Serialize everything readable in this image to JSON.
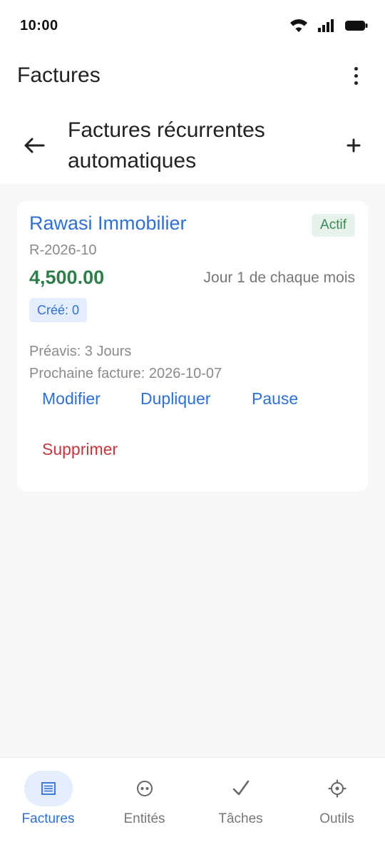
{
  "status_bar": {
    "time": "10:00"
  },
  "app_bar": {
    "title": "Factures"
  },
  "sub_header": {
    "title": "Factures récurrentes automatiques"
  },
  "invoice_card": {
    "client_name": "Rawasi Immobilier",
    "status": "Actif",
    "reference": "R-2026-10",
    "amount": "4,500.00",
    "schedule": "Jour 1 de chaque mois",
    "created_count": "Créé: 0",
    "notice": "Préavis: 3 Jours",
    "next_invoice": "Prochaine facture: 2026-10-07",
    "actions": {
      "edit": "Modifier",
      "duplicate": "Dupliquer",
      "pause": "Pause",
      "delete": "Supprimer"
    }
  },
  "bottom_nav": {
    "items": [
      {
        "label": "Factures",
        "icon": "invoice-list-icon",
        "active": true
      },
      {
        "label": "Entités",
        "icon": "entity-icon",
        "active": false
      },
      {
        "label": "Tâches",
        "icon": "checkmark-icon",
        "active": false
      },
      {
        "label": "Outils",
        "icon": "gear-icon",
        "active": false
      }
    ]
  },
  "colors": {
    "accent": "#2f6fd0",
    "amount_green": "#2f7d4a",
    "status_green_bg": "#e6f2ea",
    "delete_red": "#c0393f",
    "content_bg": "#f6f7f9"
  }
}
